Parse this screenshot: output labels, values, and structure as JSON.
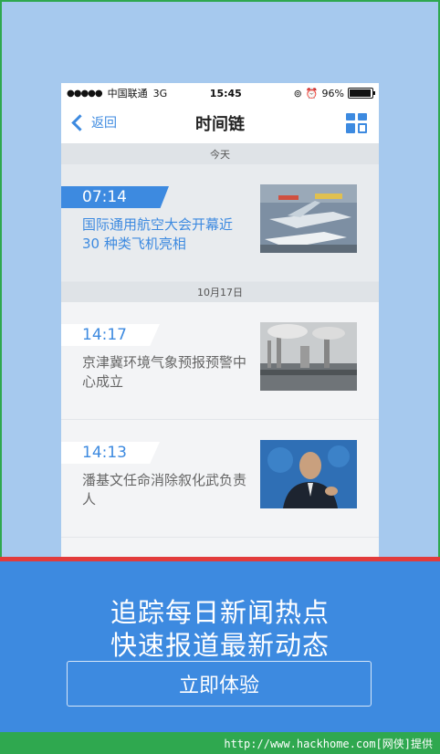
{
  "status_bar": {
    "carrier": "中国联通",
    "network": "3G",
    "time": "15:45",
    "battery": "96%",
    "battery_level": 0.96
  },
  "nav": {
    "back_label": "返回",
    "title": "时间链"
  },
  "sections": [
    {
      "date": "今天",
      "items": [
        {
          "time": "07:14",
          "headline": "国际通用航空大会开幕近 30 种类飞机亮相"
        }
      ]
    },
    {
      "date": "10月17日",
      "items": [
        {
          "time": "14:17",
          "headline": "京津冀环境气象预报预警中心成立"
        },
        {
          "time": "14:13",
          "headline": "潘基文任命消除叙化武负责人"
        }
      ]
    }
  ],
  "promo": {
    "line1": "追踪每日新闻热点",
    "line2": "快速报道最新动态",
    "cta": "立即体验"
  },
  "footer": {
    "watermark": "http://www.hackhome.com[网侠]提供"
  },
  "colors": {
    "accent": "#3d8ae0",
    "background": "#a6c9ee",
    "stripe": "#e23b3b",
    "footer": "#2fa84f"
  }
}
